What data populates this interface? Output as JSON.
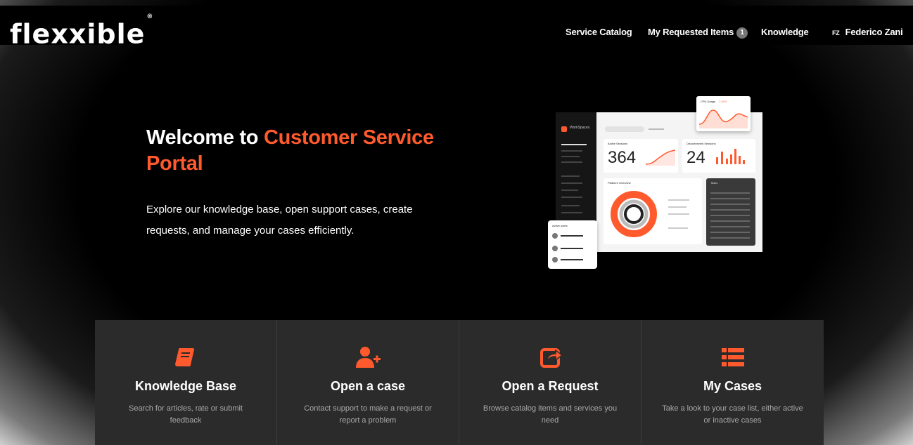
{
  "brand": {
    "name": "Flexxible",
    "trademark": "®"
  },
  "nav": {
    "service_catalog": "Service Catalog",
    "my_requested_items": "My Requested Items",
    "requested_count": "1",
    "knowledge": "Knowledge",
    "user_initials": "FZ",
    "user_name": "Federico Zani"
  },
  "hero": {
    "title_plain": "Welcome to ",
    "title_accent": "Customer Service Portal",
    "description": "Explore our knowledge base, open support cases, create requests, and manage your cases efficiently."
  },
  "illustration": {
    "app_name": "WorkSpaces",
    "cpu_label": "CPU Usage",
    "cpu_value": "7.41%",
    "active_sessions_label": "Active Sessions",
    "active_sessions_value": "364",
    "disconnected_label": "Disconnected Sessions",
    "disconnected_value": "24",
    "platform_overview": "Platform Overview",
    "tasks": "Tasks",
    "active_users": "Active users"
  },
  "tiles": [
    {
      "icon": "book-icon",
      "title": "Knowledge Base",
      "desc": "Search for articles, rate or submit feedback"
    },
    {
      "icon": "user-plus-icon",
      "title": "Open a case",
      "desc": "Contact support to make a request or report a problem"
    },
    {
      "icon": "share-icon",
      "title": "Open a Request",
      "desc": "Browse catalog items and services you need"
    },
    {
      "icon": "list-icon",
      "title": "My Cases",
      "desc": "Take a look to your case list, either active or inactive cases"
    }
  ],
  "colors": {
    "accent": "#ff5a2d",
    "tile_bg": "#2b2b2b",
    "page_bg": "#000000"
  }
}
